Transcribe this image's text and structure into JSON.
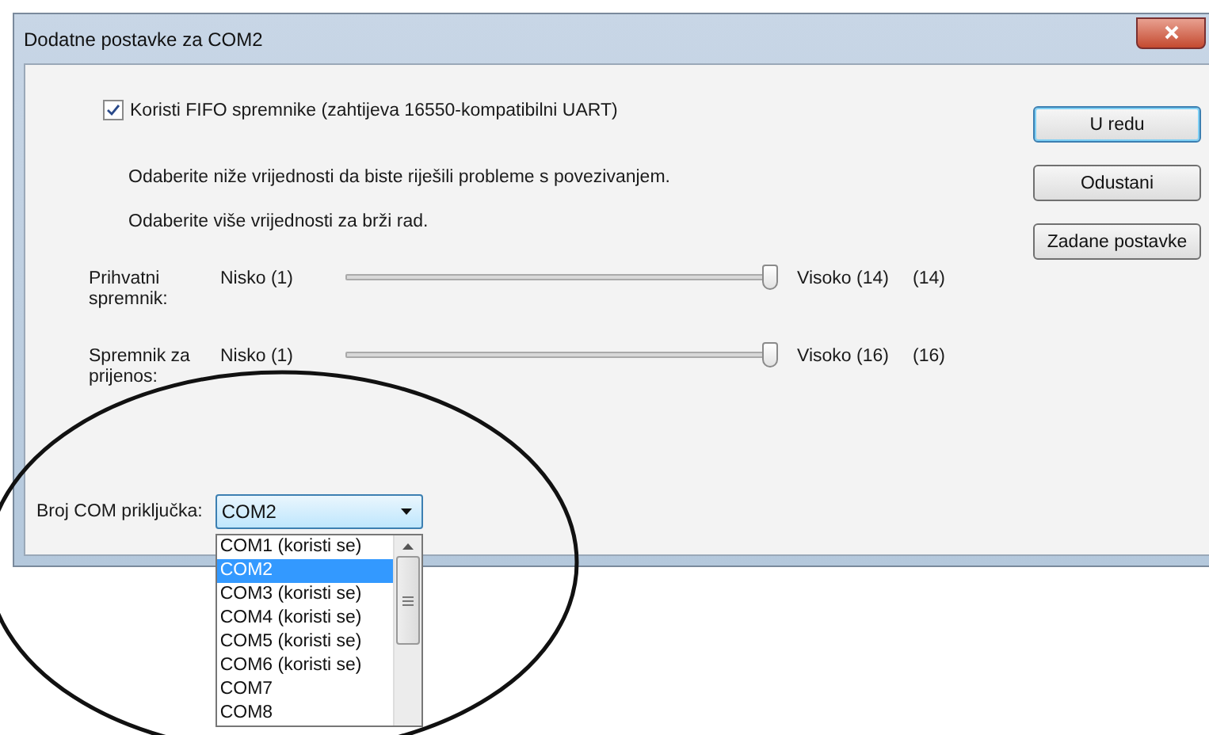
{
  "window": {
    "title": "Dodatne postavke za COM2"
  },
  "fifo": {
    "label": "Koristi FIFO spremnike (zahtijeva 16550-kompatibilni UART)",
    "checked": true
  },
  "hints": [
    "Odaberite niže vrijednosti da biste riješili probleme s povezivanjem.",
    "Odaberite više vrijednosti za brži rad."
  ],
  "sliders": [
    {
      "label": "Prihvatni spremnik:",
      "low": "Nisko (1)",
      "high": "Visoko (14)",
      "reading": "(14)",
      "level": 1
    },
    {
      "label": "Spremnik za prijenos:",
      "low": "Nisko (1)",
      "high": "Visoko (16)",
      "reading": "(16)",
      "level": 1
    }
  ],
  "buttons": [
    {
      "label": "U redu",
      "default": true
    },
    {
      "label": "Odustani",
      "default": false
    },
    {
      "label": "Zadane postavke",
      "default": false
    }
  ],
  "com_port": {
    "label": "Broj COM priključka:",
    "value": "COM2",
    "expanded": true,
    "options": [
      {
        "label": "COM1 (koristi se)",
        "selected": false
      },
      {
        "label": "COM2",
        "selected": true
      },
      {
        "label": "COM3 (koristi se)",
        "selected": false
      },
      {
        "label": "COM4 (koristi se)",
        "selected": false
      },
      {
        "label": "COM5 (koristi se)",
        "selected": false
      },
      {
        "label": "COM6 (koristi se)",
        "selected": false
      },
      {
        "label": "COM7",
        "selected": false
      },
      {
        "label": "COM8",
        "selected": false
      }
    ]
  }
}
